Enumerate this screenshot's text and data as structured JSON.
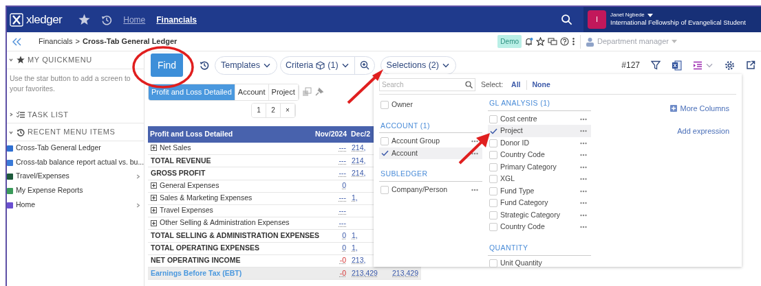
{
  "navbar": {
    "logo": "xledger",
    "items": [
      {
        "label": "Home",
        "selected": false
      },
      {
        "label": "Financials",
        "selected": true
      }
    ],
    "user": {
      "initial": "I",
      "name": "Janet Ngbede",
      "organization": "International Fellowship of Evangelical Student"
    }
  },
  "breadcrumb": {
    "separator": ">",
    "items": [
      "Financials",
      "Cross-Tab General Ledger"
    ]
  },
  "header_tools": {
    "badge": "Demo",
    "role": "Department manager"
  },
  "sidebar": {
    "sections": [
      {
        "kind": "favorites",
        "title": "MY QUICKMENU",
        "expanded": true,
        "text": "Use the star button to add a screen to your favorites."
      },
      {
        "kind": "tasks",
        "title": "TASK LIST",
        "expanded": false
      },
      {
        "kind": "recent",
        "title": "RECENT MENU ITEMS",
        "expanded": true,
        "items": [
          {
            "kind": "report",
            "label": "Cross-Tab General Ledger",
            "has_submenu": false
          },
          {
            "kind": "balance",
            "label": "Cross-tab balance report actual vs. bu...",
            "has_submenu": false
          },
          {
            "kind": "travel",
            "label": "Travel/Expenses",
            "has_submenu": true
          },
          {
            "kind": "expense",
            "label": "My Expense Reports",
            "has_submenu": false
          },
          {
            "kind": "home",
            "label": "Home",
            "has_submenu": true
          }
        ]
      }
    ]
  },
  "toolbar": {
    "find": "Find",
    "templates": "Templates",
    "criteria": "Criteria",
    "criteria_count": "(1)",
    "selections": "Selections (2)",
    "report_number": "#127"
  },
  "view_tabs": [
    {
      "label": "Profit and Loss Detailed",
      "selected": true
    },
    {
      "label": "Account",
      "selected": false
    },
    {
      "label": "Project",
      "selected": false
    }
  ],
  "pager": [
    "1",
    "2",
    "×"
  ],
  "table": {
    "label_column": "Profit and Loss Detailed",
    "columns": [
      "Nov/2024",
      "Dec/2"
    ],
    "rows": [
      {
        "kind": "group",
        "label": "Net Sales",
        "cells": [
          {
            "text": "---",
            "negative": false
          },
          {
            "text": "214,",
            "negative": false
          }
        ]
      },
      {
        "kind": "total",
        "label": "TOTAL REVENUE",
        "cells": [
          {
            "text": "---",
            "negative": false
          },
          {
            "text": "214,",
            "negative": false
          }
        ]
      },
      {
        "kind": "total",
        "label": "GROSS PROFIT",
        "cells": [
          {
            "text": "---",
            "negative": false
          },
          {
            "text": "214,",
            "negative": false
          }
        ]
      },
      {
        "kind": "group",
        "label": "General Expenses",
        "cells": [
          {
            "text": "0",
            "negative": false
          }
        ]
      },
      {
        "kind": "group",
        "label": "Sales & Marketing Expenses",
        "cells": [
          {
            "text": "---",
            "negative": false
          },
          {
            "text": "1,",
            "negative": false
          }
        ]
      },
      {
        "kind": "group",
        "label": "Travel Expenses",
        "cells": [
          {
            "text": "---",
            "negative": false
          }
        ]
      },
      {
        "kind": "group",
        "label": "Other Selling & Administration Expenses",
        "cells": [
          {
            "text": "---",
            "negative": false
          }
        ]
      },
      {
        "kind": "total",
        "label": "TOTAL SELLING & ADMINISTRATION EXPENSES",
        "cells": [
          {
            "text": "0",
            "negative": false
          },
          {
            "text": "1,",
            "negative": false
          }
        ]
      },
      {
        "kind": "total",
        "label": "TOTAL OPERATING EXPENSES",
        "cells": [
          {
            "text": "0",
            "negative": false
          },
          {
            "text": "1,",
            "negative": false
          }
        ]
      },
      {
        "kind": "total",
        "label": "NET OPERATING INCOME",
        "cells": [
          {
            "text": "-0",
            "negative": true
          },
          {
            "text": "213,",
            "negative": false
          }
        ]
      },
      {
        "kind": "result",
        "label": "Earnings Before Tax (EBT)",
        "cells": [
          {
            "text": "-0",
            "negative": true
          },
          {
            "text": "213,429",
            "negative": false
          },
          {
            "text": "213,429",
            "negative": false
          }
        ]
      }
    ]
  },
  "selections_panel": {
    "search": {
      "placeholder": "Search"
    },
    "select_label": "Select:",
    "select_all": "All",
    "select_none": "None",
    "more_columns": "More Columns",
    "add_expression": "Add expression",
    "columns": [
      [
        {
          "items": [
            {
              "label": "Owner",
              "checked": false,
              "has_menu": false
            }
          ]
        },
        {
          "title": "ACCOUNT (1)",
          "items": [
            {
              "label": "Account Group",
              "checked": false,
              "has_menu": true
            },
            {
              "label": "Account",
              "checked": true,
              "has_menu": true
            }
          ]
        },
        {
          "title": "SUBLEDGER",
          "items": [
            {
              "label": "Company/Person",
              "checked": false,
              "has_menu": true
            }
          ]
        }
      ],
      [
        {
          "title": "GL ANALYSIS (1)",
          "items": [
            {
              "label": "Cost centre",
              "checked": false,
              "has_menu": true
            },
            {
              "label": "Project",
              "checked": true,
              "has_menu": true
            },
            {
              "label": "Donor ID",
              "checked": false,
              "has_menu": true
            },
            {
              "label": "Country Code",
              "checked": false,
              "has_menu": true
            },
            {
              "label": "Primary Category",
              "checked": false,
              "has_menu": true
            },
            {
              "label": "XGL",
              "checked": false,
              "has_menu": true
            },
            {
              "label": "Fund Type",
              "checked": false,
              "has_menu": true
            },
            {
              "label": "Fund Category",
              "checked": false,
              "has_menu": true
            },
            {
              "label": "Strategic Category",
              "checked": false,
              "has_menu": true
            },
            {
              "label": "Country Code",
              "checked": false,
              "has_menu": true
            }
          ]
        },
        {
          "title": "QUANTITY",
          "items": [
            {
              "label": "Unit Quantity",
              "checked": false,
              "has_menu": false
            }
          ]
        }
      ]
    ]
  }
}
